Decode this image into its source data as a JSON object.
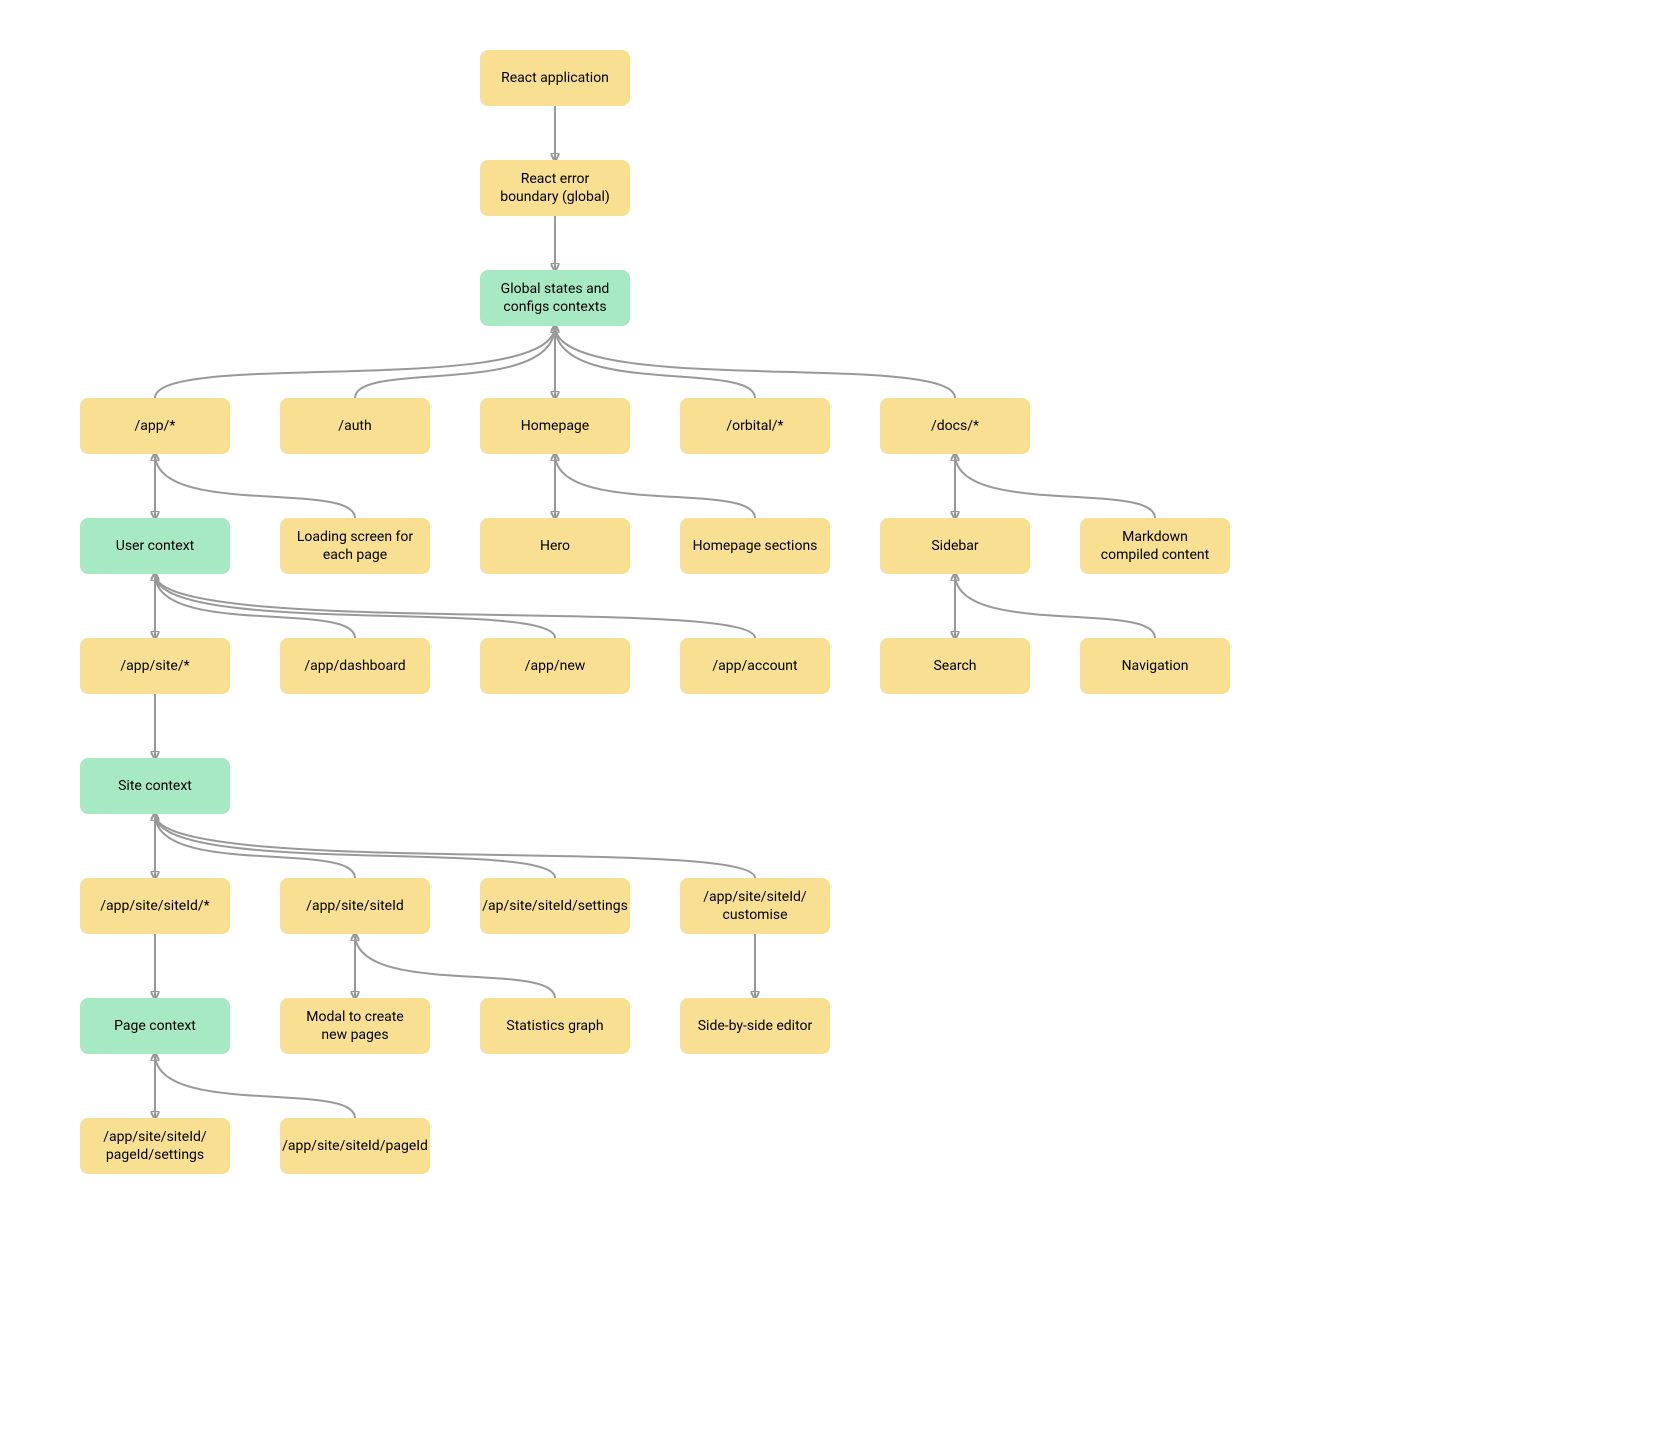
{
  "colors": {
    "yellow": "#f8df91",
    "green": "#a7e9c3",
    "edge": "#999999"
  },
  "nodes": {
    "react_app": {
      "label": "React application",
      "color": "yellow"
    },
    "error_boundary": {
      "label": "React error boundary (global)",
      "color": "yellow"
    },
    "global_states": {
      "label": "Global states and configs contexts",
      "color": "green"
    },
    "app_star": {
      "label": "/app/*",
      "color": "yellow"
    },
    "auth": {
      "label": "/auth",
      "color": "yellow"
    },
    "homepage": {
      "label": "Homepage",
      "color": "yellow"
    },
    "orbital": {
      "label": "/orbital/*",
      "color": "yellow"
    },
    "docs": {
      "label": "/docs/*",
      "color": "yellow"
    },
    "user_context": {
      "label": "User context",
      "color": "green"
    },
    "loading_screen": {
      "label": "Loading screen for each page",
      "color": "yellow"
    },
    "hero": {
      "label": "Hero",
      "color": "yellow"
    },
    "homepage_sections": {
      "label": "Homepage sections",
      "color": "yellow"
    },
    "sidebar_docs": {
      "label": "Sidebar",
      "color": "yellow"
    },
    "markdown_content": {
      "label": "Markdown compiled content",
      "color": "yellow"
    },
    "app_site_star": {
      "label": "/app/site/*",
      "color": "yellow"
    },
    "app_dashboard": {
      "label": "/app/dashboard",
      "color": "yellow"
    },
    "app_new": {
      "label": "/app/new",
      "color": "yellow"
    },
    "app_account": {
      "label": "/app/account",
      "color": "yellow"
    },
    "search": {
      "label": "Search",
      "color": "yellow"
    },
    "navigation": {
      "label": "Navigation",
      "color": "yellow"
    },
    "site_context": {
      "label": "Site context",
      "color": "green"
    },
    "site_id_star": {
      "label": "/app/site/siteId/*",
      "color": "yellow"
    },
    "site_id": {
      "label": "/app/site/siteId",
      "color": "yellow"
    },
    "site_id_settings": {
      "label": "/ap/site/siteId/settings",
      "color": "yellow"
    },
    "site_id_customise": {
      "label": "/app/site/siteId/ customise",
      "color": "yellow"
    },
    "page_context": {
      "label": "Page context",
      "color": "green"
    },
    "modal_new_pages": {
      "label": "Modal to create new pages",
      "color": "yellow"
    },
    "stats_graph": {
      "label": "Statistics graph",
      "color": "yellow"
    },
    "side_editor": {
      "label": "Side-by-side editor",
      "color": "yellow"
    },
    "page_settings": {
      "label": "/app/site/siteId/ pageId/settings",
      "color": "yellow"
    },
    "page_id": {
      "label": "/app/site/siteId/pageId",
      "color": "yellow"
    }
  }
}
